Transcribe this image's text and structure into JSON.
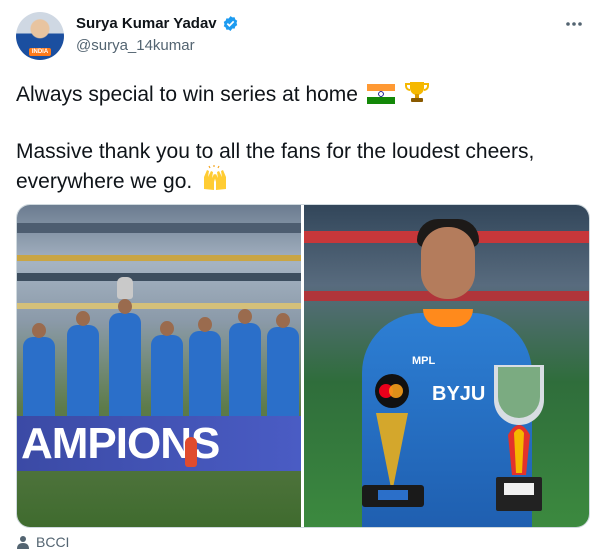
{
  "author": {
    "display_name": "Surya Kumar Yadav",
    "handle": "@surya_14kumar",
    "verified": true,
    "avatar_tag": "INDIA"
  },
  "tweet": {
    "line1": "Always special to win series at home",
    "line1_emojis": [
      "india-flag-icon",
      "trophy-icon"
    ],
    "line2": "Massive thank you to all the fans for the loudest cheers, everywhere we go.",
    "line2_emojis": [
      "raising-hands-icon"
    ]
  },
  "media": {
    "left_banner": "AMPIONS",
    "right_sponsor_1": "MPL",
    "right_sponsor_2": "BYJU"
  },
  "source": {
    "label": "BCCI"
  },
  "colors": {
    "verified": "#1d9bf0",
    "secondary_text": "#536471",
    "jersey_blue": "#2b6fc9"
  }
}
